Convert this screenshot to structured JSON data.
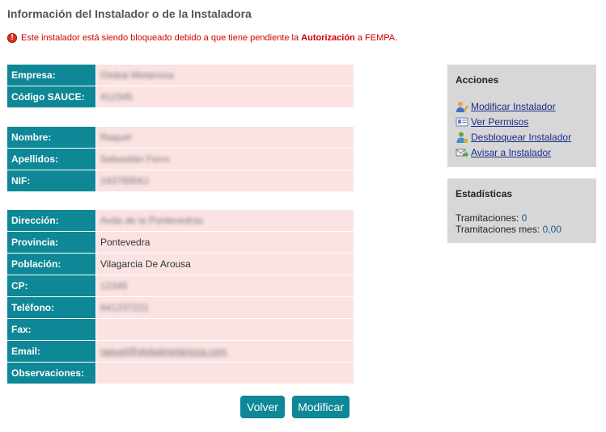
{
  "title": "Información del Instalador o de la Instaladora",
  "warning": {
    "prefix": "Este instalador está siendo bloqueado debido a que tiene pendiente la ",
    "bold": "Autorización",
    "suffix": " a FEMPA."
  },
  "groups": [
    [
      {
        "label": "Empresa:",
        "value": "Global Metanosa",
        "blurred": true
      },
      {
        "label": "Código SAUCE:",
        "value": "412345",
        "blurred": true
      }
    ],
    [
      {
        "label": "Nombre:",
        "value": "Raquel",
        "blurred": true
      },
      {
        "label": "Apellidos:",
        "value": "Sebastián Ferro",
        "blurred": true
      },
      {
        "label": "NIF:",
        "value": "24378956J",
        "blurred": true
      }
    ],
    [
      {
        "label": "Dirección:",
        "value": "Avda de la Pontevedras",
        "blurred": true
      },
      {
        "label": "Provincia:",
        "value": "Pontevedra",
        "blurred": false
      },
      {
        "label": "Población:",
        "value": "Vilagarcia De Arousa",
        "blurred": false
      },
      {
        "label": "CP:",
        "value": "12345",
        "blurred": true
      },
      {
        "label": "Teléfono:",
        "value": "641237221",
        "blurred": true
      },
      {
        "label": "Fax:",
        "value": "",
        "blurred": false
      },
      {
        "label": "Email:",
        "value": "raquel@globalmetanosa.com",
        "blurred": true,
        "link": true
      },
      {
        "label": "Observaciones:",
        "value": "",
        "blurred": false
      }
    ]
  ],
  "buttons": {
    "back": "Volver",
    "modify": "Modificar"
  },
  "acciones": {
    "title": "Acciones",
    "items": [
      {
        "label": "Modificar Instalador",
        "icon": "user-edit-icon"
      },
      {
        "label": "Ver Permisos",
        "icon": "id-card-icon"
      },
      {
        "label": "Desbloquear Instalador",
        "icon": "user-unlock-icon"
      },
      {
        "label": "Avisar a Instalador",
        "icon": "mail-send-icon"
      }
    ]
  },
  "estadisticas": {
    "title": "Estadísticas",
    "tramitaciones_label": "Tramitaciones: ",
    "tramitaciones_value": "0",
    "tramitaciones_mes_label": "Tramitaciones mes: ",
    "tramitaciones_mes_value": "0,00"
  },
  "colors": {
    "accent": "#0e8796",
    "value_bg": "#fbe3e3",
    "warning": "#cc0000",
    "panel_bg": "#d7d7d7"
  }
}
